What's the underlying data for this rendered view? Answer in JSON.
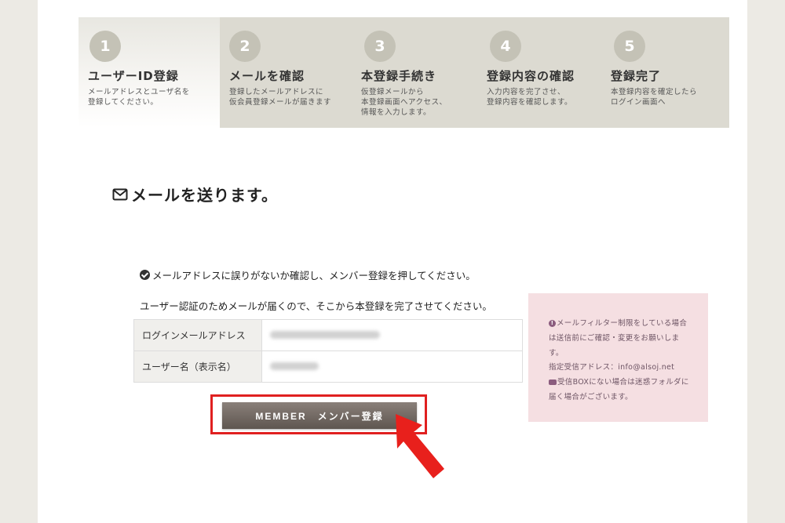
{
  "steps": [
    {
      "num": "1",
      "title": "ユーザーID登録",
      "desc": "メールアドレスとユーザ名を\n登録してください。"
    },
    {
      "num": "2",
      "title": "メールを確認",
      "desc": "登録したメールアドレスに\n仮会員登録メールが届きます"
    },
    {
      "num": "3",
      "title": "本登録手続き",
      "desc": "仮登録メールから\n本登録画面へアクセス、\n情報を入力します。"
    },
    {
      "num": "4",
      "title": "登録内容の確認",
      "desc": "入力内容を完了させ、\n登録内容を確認します。"
    },
    {
      "num": "5",
      "title": "登録完了",
      "desc": "本登録内容を確定したら\nログイン画面へ"
    }
  ],
  "main": {
    "heading": "メールを送ります。",
    "confirm_text": "メールアドレスに誤りがないか確認し、メンバー登録を押してください。",
    "notice_text": "ユーザー認証のためメールが届くので、そこから本登録を完了させてください。"
  },
  "table": {
    "rows": [
      {
        "label": "ログインメールアドレス"
      },
      {
        "label": "ユーザー名（表示名）"
      }
    ]
  },
  "member_button": {
    "label": "MEMBER　メンバー登録"
  },
  "side_notice": {
    "line1": "メールフィルター制限をしている場合",
    "line2": "は送信前にご確認・変更をお願いしま",
    "line3": "す。",
    "line4": "指定受信アドレス：info@alsoj.net",
    "line5": "受信BOXにない場合は迷惑フォルダに",
    "line6": "届く場合がございます。"
  },
  "colors": {
    "accent_red": "#e02020",
    "pink_bg": "#f5dfe2",
    "step_bg": "#dcdad1"
  }
}
